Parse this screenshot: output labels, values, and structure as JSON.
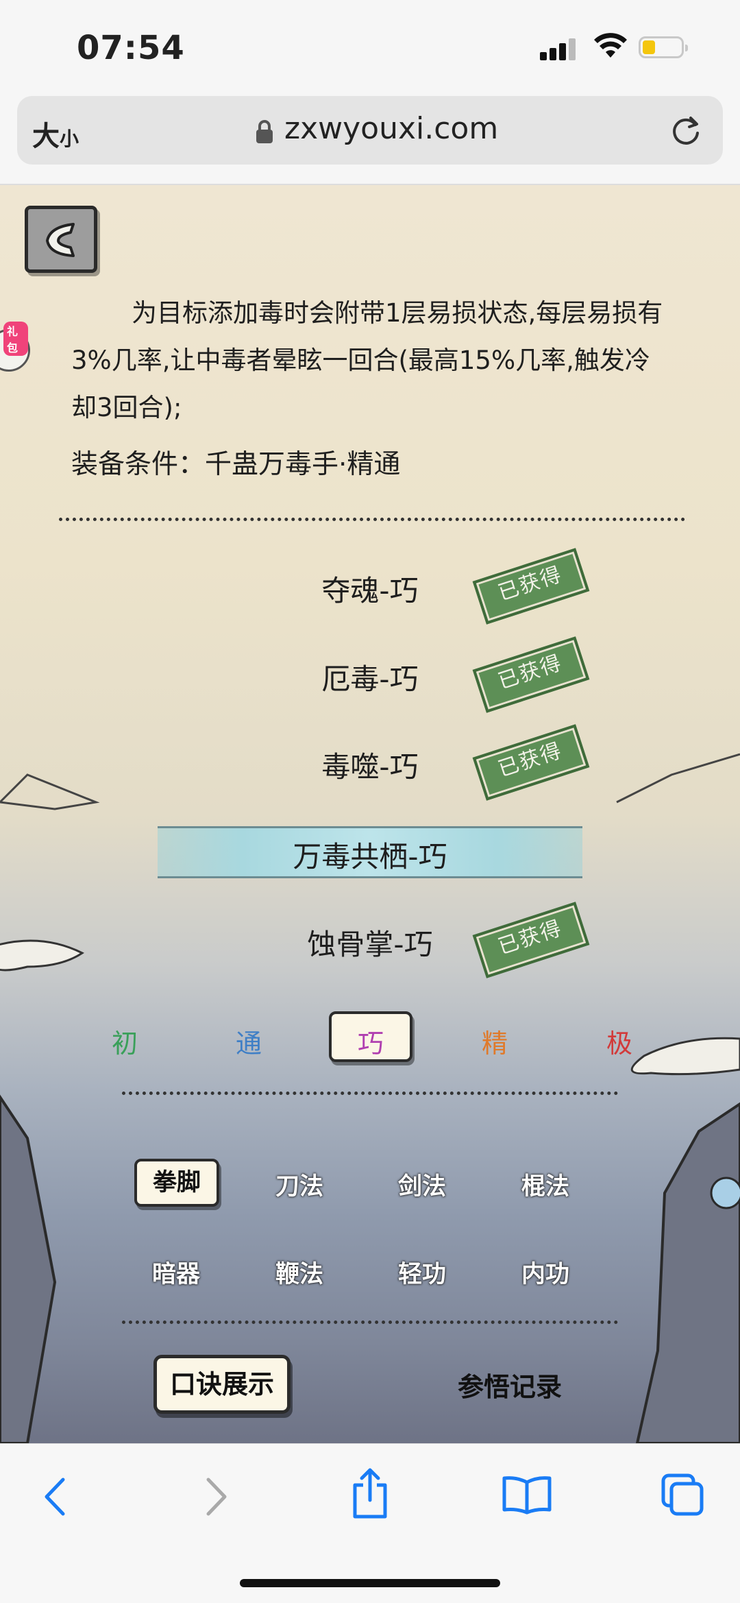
{
  "status_bar": {
    "time": "07:54"
  },
  "browser": {
    "text_size_big": "大",
    "text_size_small": "小",
    "url": "zxwyouxi.com"
  },
  "game": {
    "gift_badge": "礼包",
    "description": "为目标添加毒时会附带1层易损状态,每层易损有3%几率,让中毒者晕眩一回合(最高15%几率,触发冷却3回合);",
    "equip_condition": "装备条件：千蛊万毒手·精通",
    "techniques": [
      {
        "name": "夺魂-巧",
        "status": "已获得"
      },
      {
        "name": "厄毒-巧",
        "status": "已获得"
      },
      {
        "name": "毒噬-巧",
        "status": "已获得"
      },
      {
        "name": "万毒共栖-巧",
        "status": ""
      },
      {
        "name": "蚀骨掌-巧",
        "status": "已获得"
      }
    ],
    "tiers": [
      {
        "label": "初",
        "color": "#3aa05a"
      },
      {
        "label": "通",
        "color": "#3f7fc6"
      },
      {
        "label": "巧",
        "color": "#b03fb0"
      },
      {
        "label": "精",
        "color": "#e07a2a"
      },
      {
        "label": "极",
        "color": "#d23a3a"
      }
    ],
    "selected_tier": "巧",
    "categories": [
      "拳脚",
      "刀法",
      "剑法",
      "棍法",
      "暗器",
      "鞭法",
      "轻功",
      "内功"
    ],
    "selected_category": "拳脚",
    "show_button": "口诀展示",
    "record_button": "参悟记录"
  },
  "toolbar": {
    "icons": [
      "back-icon",
      "forward-icon",
      "share-icon",
      "bookmarks-icon",
      "tabs-icon"
    ],
    "accent": "#1a7cf5"
  }
}
